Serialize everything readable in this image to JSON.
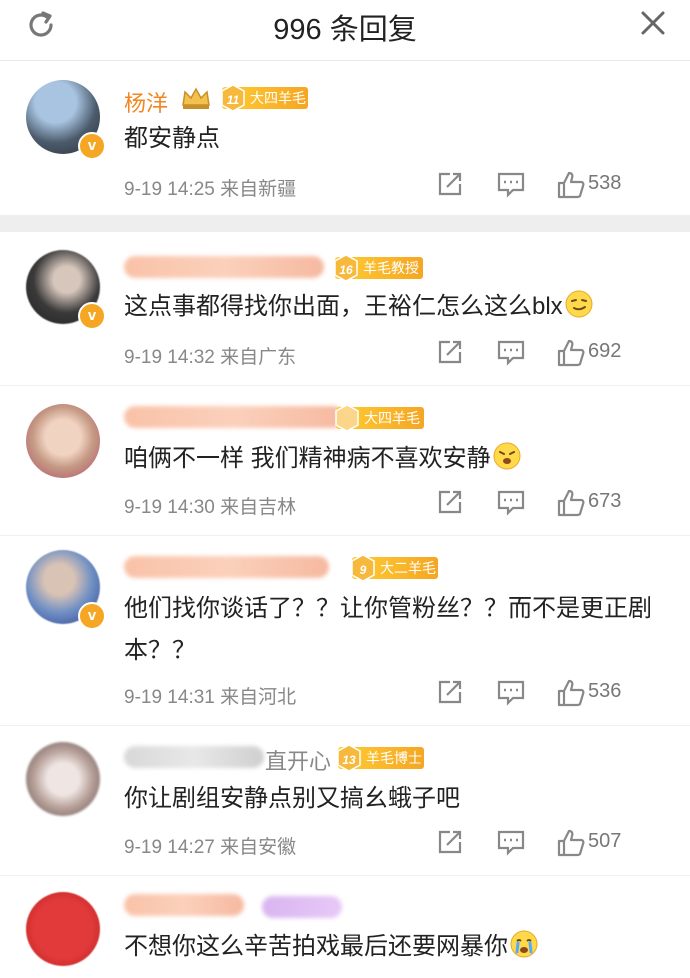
{
  "header": {
    "title": "996 条回复"
  },
  "comments": [
    {
      "name": "杨洋",
      "fan_level": "11",
      "fan_label": "大四羊毛",
      "text": "都安静点",
      "emoji": "",
      "time": "9-19 14:25",
      "source": "来自新疆",
      "likes": "538"
    },
    {
      "name": "",
      "fan_level": "16",
      "fan_label": "羊毛教授",
      "text": "这点事都得找你出面，王裕仁怎么这么blx",
      "emoji": "smirk-emoji",
      "time": "9-19 14:32",
      "source": "来自广东",
      "likes": "692"
    },
    {
      "name": "",
      "fan_level": "",
      "fan_label": "大四羊毛",
      "text": "咱俩不一样  我们精神病不喜欢安静",
      "emoji": "cry-emoji",
      "time": "9-19 14:30",
      "source": "来自吉林",
      "likes": "673"
    },
    {
      "name": "",
      "fan_level": "9",
      "fan_label": "大二羊毛",
      "text": "他们找你谈话了？？让你管粉丝？？而不是更正剧本？？",
      "emoji": "",
      "time": "9-19 14:31",
      "source": "来自河北",
      "likes": "536"
    },
    {
      "name": "",
      "name_tail": "直开心",
      "fan_level": "13",
      "fan_label": "羊毛博士",
      "text": "你让剧组安静点别又搞幺蛾子吧",
      "emoji": "",
      "time": "9-19 14:27",
      "source": "来自安徽",
      "likes": "507"
    },
    {
      "name": "",
      "fan_level": "",
      "fan_label": "",
      "text": "不想你这么辛苦拍戏最后还要网暴你",
      "emoji": "crying-emoji",
      "time": "",
      "source": "",
      "likes": ""
    }
  ],
  "icons": {
    "refresh": "refresh-icon",
    "close": "close-icon",
    "share": "share-icon",
    "comment": "comment-icon",
    "like": "like-icon"
  },
  "colors": {
    "name_orange": "#f08722",
    "badge_orange": "#f5a623",
    "divider": "#eeeeee"
  }
}
